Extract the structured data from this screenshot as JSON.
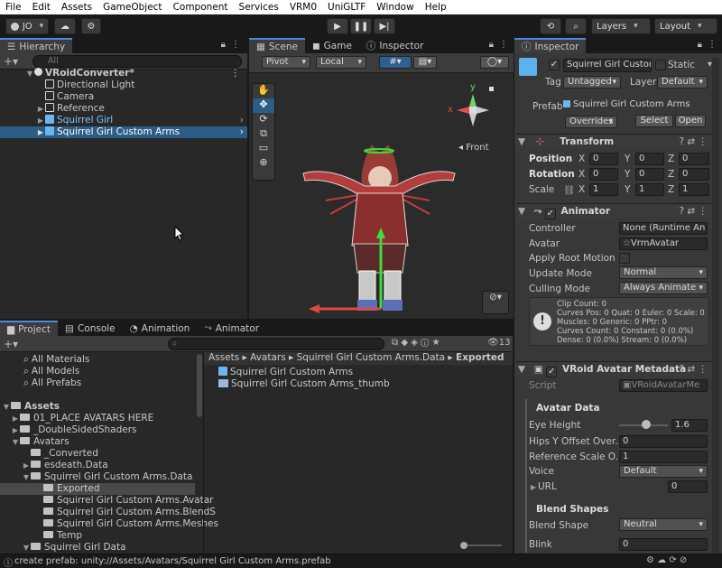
{
  "menu": [
    "File",
    "Edit",
    "Assets",
    "GameObject",
    "Component",
    "Services",
    "VRM0",
    "UniGLTF",
    "Window",
    "Help"
  ],
  "toolbar": {
    "account": "JO",
    "layers": "Layers",
    "layout": "Layout"
  },
  "hierarchy": {
    "tab": "Hierarchy",
    "search_placeholder": "All",
    "scene": "VRoidConverter*",
    "items": [
      "Directional Light",
      "Camera",
      "Reference",
      "Squirrel Girl",
      "Squirrel Girl Custom Arms"
    ]
  },
  "center_tabs": [
    "Scene",
    "Game",
    "Inspector"
  ],
  "scene_toolbar": {
    "pivot": "Pivot",
    "local": "Local"
  },
  "gizmo": {
    "y": "y",
    "x": "x",
    "view": "Front"
  },
  "project": {
    "tabs": [
      "Project",
      "Console",
      "Animation",
      "Animator"
    ],
    "badge": "13",
    "favorites": [
      "All Materials",
      "All Models",
      "All Prefabs"
    ],
    "assets_root": "Assets",
    "tree": [
      "01_PLACE AVATARS HERE",
      "_DoubleSidedShaders",
      "Avatars",
      "_Converted",
      "esdeath.Data",
      "Squirrel Girl Custom Arms.Data",
      "Exported",
      "Squirrel Girl Custom Arms.Avatar",
      "Squirrel Girl Custom Arms.BlendS",
      "Squirrel Girl Custom Arms.Meshes",
      "Temp",
      "Squirrel Girl Data"
    ],
    "breadcrumb": [
      "Assets",
      "Avatars",
      "Squirrel Girl Custom Arms.Data",
      "Exported"
    ],
    "files": [
      "Squirrel Girl Custom Arms",
      "Squirrel Girl Custom Arms_thumb"
    ]
  },
  "inspector": {
    "tab": "Inspector",
    "object_name": "Squirrel Girl Custor",
    "static": "Static",
    "tag_label": "Tag",
    "tag": "Untagged",
    "layer_label": "Layer",
    "layer": "Default",
    "prefab_label": "Prefab",
    "prefab": "Squirrel Girl Custom Arms",
    "overrides": "Overrides",
    "select": "Select",
    "open": "Open",
    "transform": {
      "title": "Transform",
      "position_label": "Position",
      "rotation_label": "Rotation",
      "scale_label": "Scale",
      "axis_x": "X",
      "axis_y": "Y",
      "axis_z": "Z",
      "position": [
        "0",
        "0",
        "0"
      ],
      "rotation": [
        "0",
        "0",
        "0"
      ],
      "scale": [
        "1",
        "1",
        "1"
      ]
    },
    "animator": {
      "title": "Animator",
      "controller_label": "Controller",
      "controller": "None (Runtime An",
      "avatar_label": "Avatar",
      "avatar": "VrmAvatar",
      "root_motion_label": "Apply Root Motion",
      "update_mode_label": "Update Mode",
      "update_mode": "Normal",
      "culling_mode_label": "Culling Mode",
      "culling_mode": "Always Animate",
      "info": [
        "Clip Count: 0",
        "Curves Pos: 0 Quat: 0 Euler: 0 Scale: 0",
        "Muscles: 0 Generic: 0 PPtr: 0",
        "Curves Count: 0 Constant: 0 (0.0%)",
        "Dense: 0 (0.0%) Stream: 0 (0.0%)"
      ]
    },
    "vroid": {
      "title": "VRoid Avatar Metadata",
      "script_label": "Script",
      "script": "VRoidAvatarMe",
      "avatar_data": "Avatar Data",
      "eye_height_label": "Eye Height",
      "eye_height": "1.6",
      "eye_height_fraction": 0.55,
      "hips_label": "Hips Y Offset Over...",
      "hips": "0",
      "ref_scale_label": "Reference Scale O...",
      "ref_scale": "1",
      "voice_label": "Voice",
      "voice": "Default",
      "url_label": "URL",
      "url": "0",
      "blend_shapes": "Blend Shapes",
      "blend_shape_label": "Blend Shape",
      "blend_shape": "Neutral",
      "blink_label": "Blink",
      "blink": "0"
    }
  },
  "status": "create prefab: unity://Assets/Avatars/Squirrel Girl Custom Arms.prefab"
}
